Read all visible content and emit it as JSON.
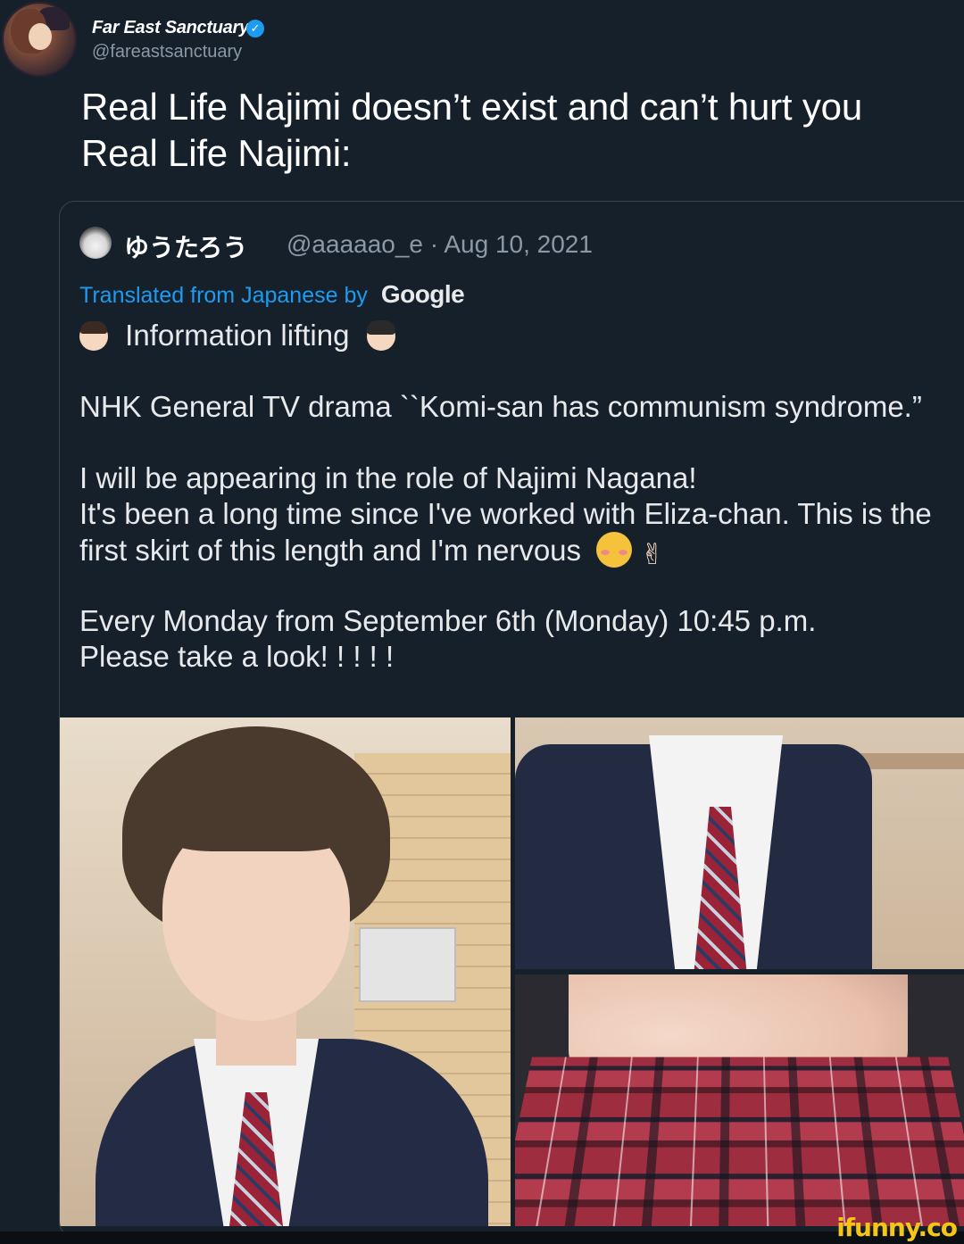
{
  "tweet": {
    "author_name": "Far East Sanctuary",
    "author_handle": "@fareastsanctuary",
    "text_lines": [
      "Real Life Najimi doesn’t exist and can’t hurt you",
      "Real Life Najimi:"
    ]
  },
  "quote": {
    "author_name": "ゆうたろう",
    "meta": "@aaaaao_e · Aug 10, 2021",
    "translated_label": "Translated from Japanese by",
    "translator": "Google",
    "body": {
      "info_line": "Information lifting",
      "drama_line": "NHK General TV drama ``Komi-san has communism syndrome.”",
      "role_line": "I will be appearing in the role of Najimi Nagana!",
      "eliza_line": "It's been a long time since I've worked with Eliza-chan. This is the",
      "skirt_line": "first skirt of this length and I'm nervous",
      "schedule_line": "Every Monday from September 6th (Monday) 10:45 p.m.",
      "look_line": "Please take a look! ! ! ! !"
    },
    "media_count": 3
  },
  "watermark": "ifunny.co",
  "colors": {
    "background": "#15202b",
    "link_blue": "#1d9bf0",
    "verified_blue": "#1d9bf0",
    "muted_text": "#8b98a5",
    "watermark_yellow": "#f5c518"
  },
  "icons": {
    "verified": "verified-badge-icon",
    "face_boy": "boy-face-emoji",
    "face_girl": "girl-face-emoji",
    "blush": "smiling-blush-emoji",
    "victory": "victory-hand-emoji"
  }
}
